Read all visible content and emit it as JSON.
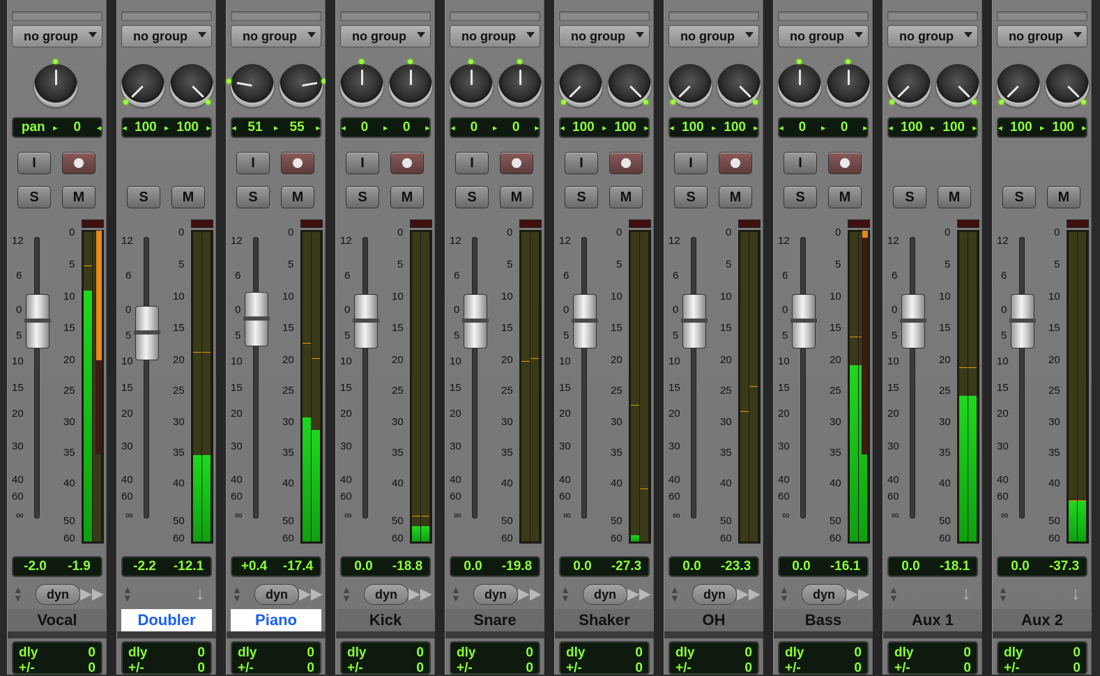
{
  "tracks": [
    {
      "name": "Vocal",
      "selected": false,
      "group": "no group",
      "knobs": 1,
      "knob_label": "pan",
      "knob_values": [
        "0"
      ],
      "input": true,
      "rec": true,
      "vol_left": "-2.0",
      "vol_right": "-1.9",
      "dyn": true,
      "auto": "play",
      "dly": "0",
      "dly2": "+/-",
      "dly2v": "0",
      "meter": [
        0.81,
        0.0
      ],
      "peak": [
        0.89,
        0.0
      ],
      "clip_side": 0.58,
      "fader": 0.0
    },
    {
      "name": "Doubler",
      "selected": true,
      "group": "no group",
      "knobs": 2,
      "knob_values": [
        "100",
        "100"
      ],
      "input": false,
      "rec": false,
      "vol_left": "-2.2",
      "vol_right": "-12.1",
      "dyn": false,
      "auto": "down",
      "dly": "0",
      "dly2": "+/-",
      "dly2v": "0",
      "meter": [
        0.28,
        0.28
      ],
      "peak": [
        0.61,
        0.61
      ],
      "clip_side": null,
      "fader": -2.2
    },
    {
      "name": "Piano",
      "selected": true,
      "group": "no group",
      "knobs": 2,
      "knob_values": [
        "51",
        "55"
      ],
      "input": true,
      "rec": true,
      "vol_left": "+0.4",
      "vol_right": "-17.4",
      "dyn": true,
      "auto": "play",
      "dly": "0",
      "dly2": "+/-",
      "dly2v": "0",
      "meter": [
        0.4,
        0.36
      ],
      "peak": [
        0.64,
        0.59
      ],
      "clip_side": null,
      "fader": 0.4
    },
    {
      "name": "Kick",
      "selected": false,
      "group": "no group",
      "knobs": 2,
      "knob_values": [
        "0",
        "0"
      ],
      "input": true,
      "rec": true,
      "vol_left": "0.0",
      "vol_right": "-18.8",
      "dyn": true,
      "auto": "play",
      "dly": "0",
      "dly2": "+/-",
      "dly2v": "0",
      "meter": [
        0.05,
        0.05
      ],
      "peak": [
        0.08,
        0.08
      ],
      "clip_side": null,
      "fader": 0.0
    },
    {
      "name": "Snare",
      "selected": false,
      "group": "no group",
      "knobs": 2,
      "knob_values": [
        "0",
        "0"
      ],
      "input": true,
      "rec": true,
      "vol_left": "0.0",
      "vol_right": "-19.8",
      "dyn": true,
      "auto": "play",
      "dly": "0",
      "dly2": "+/-",
      "dly2v": "0",
      "meter": [
        0.0,
        0.0
      ],
      "peak": [
        0.58,
        0.59
      ],
      "clip_side": null,
      "fader": 0.0
    },
    {
      "name": "Shaker",
      "selected": false,
      "group": "no group",
      "knobs": 2,
      "knob_values": [
        "100",
        "100"
      ],
      "input": true,
      "rec": true,
      "vol_left": "0.0",
      "vol_right": "-27.3",
      "dyn": true,
      "auto": "play",
      "dly": "0",
      "dly2": "+/-",
      "dly2v": "0",
      "meter": [
        0.02,
        0.0
      ],
      "peak": [
        0.44,
        0.17
      ],
      "clip_side": null,
      "fader": 0.0
    },
    {
      "name": "OH",
      "selected": false,
      "group": "no group",
      "knobs": 2,
      "knob_values": [
        "100",
        "100"
      ],
      "input": true,
      "rec": true,
      "vol_left": "0.0",
      "vol_right": "-23.3",
      "dyn": true,
      "auto": "play",
      "dly": "0",
      "dly2": "+/-",
      "dly2v": "0",
      "meter": [
        0.0,
        0.0
      ],
      "peak": [
        0.42,
        0.5
      ],
      "clip_side": null,
      "fader": 0.0
    },
    {
      "name": "Bass",
      "selected": false,
      "group": "no group",
      "knobs": 2,
      "knob_values": [
        "0",
        "0"
      ],
      "input": true,
      "rec": true,
      "vol_left": "0.0",
      "vol_right": "-16.1",
      "dyn": true,
      "auto": "play",
      "dly": "0",
      "dly2": "+/-",
      "dly2v": "0",
      "meter": [
        0.57,
        0.57
      ],
      "peak": [
        0.66,
        0.66
      ],
      "clip_side": 0.0,
      "fader": 0.0
    },
    {
      "name": "Aux 1",
      "selected": false,
      "group": "no group",
      "knobs": 2,
      "knob_values": [
        "100",
        "100"
      ],
      "input": false,
      "rec": false,
      "vol_left": "0.0",
      "vol_right": "-18.1",
      "dyn": false,
      "auto": "down",
      "dly": "0",
      "dly2": "+/-",
      "dly2v": "0",
      "meter": [
        0.47,
        0.47
      ],
      "peak": [
        0.56,
        0.56
      ],
      "clip_side": null,
      "fader": 0.0
    },
    {
      "name": "Aux 2",
      "selected": false,
      "group": "no group",
      "knobs": 2,
      "knob_values": [
        "100",
        "100"
      ],
      "input": false,
      "rec": false,
      "vol_left": "0.0",
      "vol_right": "-37.3",
      "dyn": false,
      "auto": "down",
      "dly": "0",
      "dly2": "+/-",
      "dly2v": "0",
      "meter": [
        0.13,
        0.13
      ],
      "peak": [
        0.13,
        0.13
      ],
      "clip_side": null,
      "fader": 0.0
    }
  ],
  "labels": {
    "solo": "S",
    "mute": "M",
    "input": "I",
    "dyn": "dyn",
    "dly": "dly"
  },
  "fader_scale": [
    "12",
    "6",
    "0",
    "5",
    "10",
    "15",
    "20",
    "30",
    "40",
    "60",
    "∞"
  ],
  "meter_scale": [
    "0",
    "5",
    "10",
    "15",
    "20",
    "25",
    "30",
    "35",
    "40",
    "50",
    "60"
  ],
  "colors": {
    "display_text": "#8dff37",
    "meter_green": "#1fd81f",
    "peak_marker": "#e3a100",
    "selected_name": "#1a5ef2"
  }
}
